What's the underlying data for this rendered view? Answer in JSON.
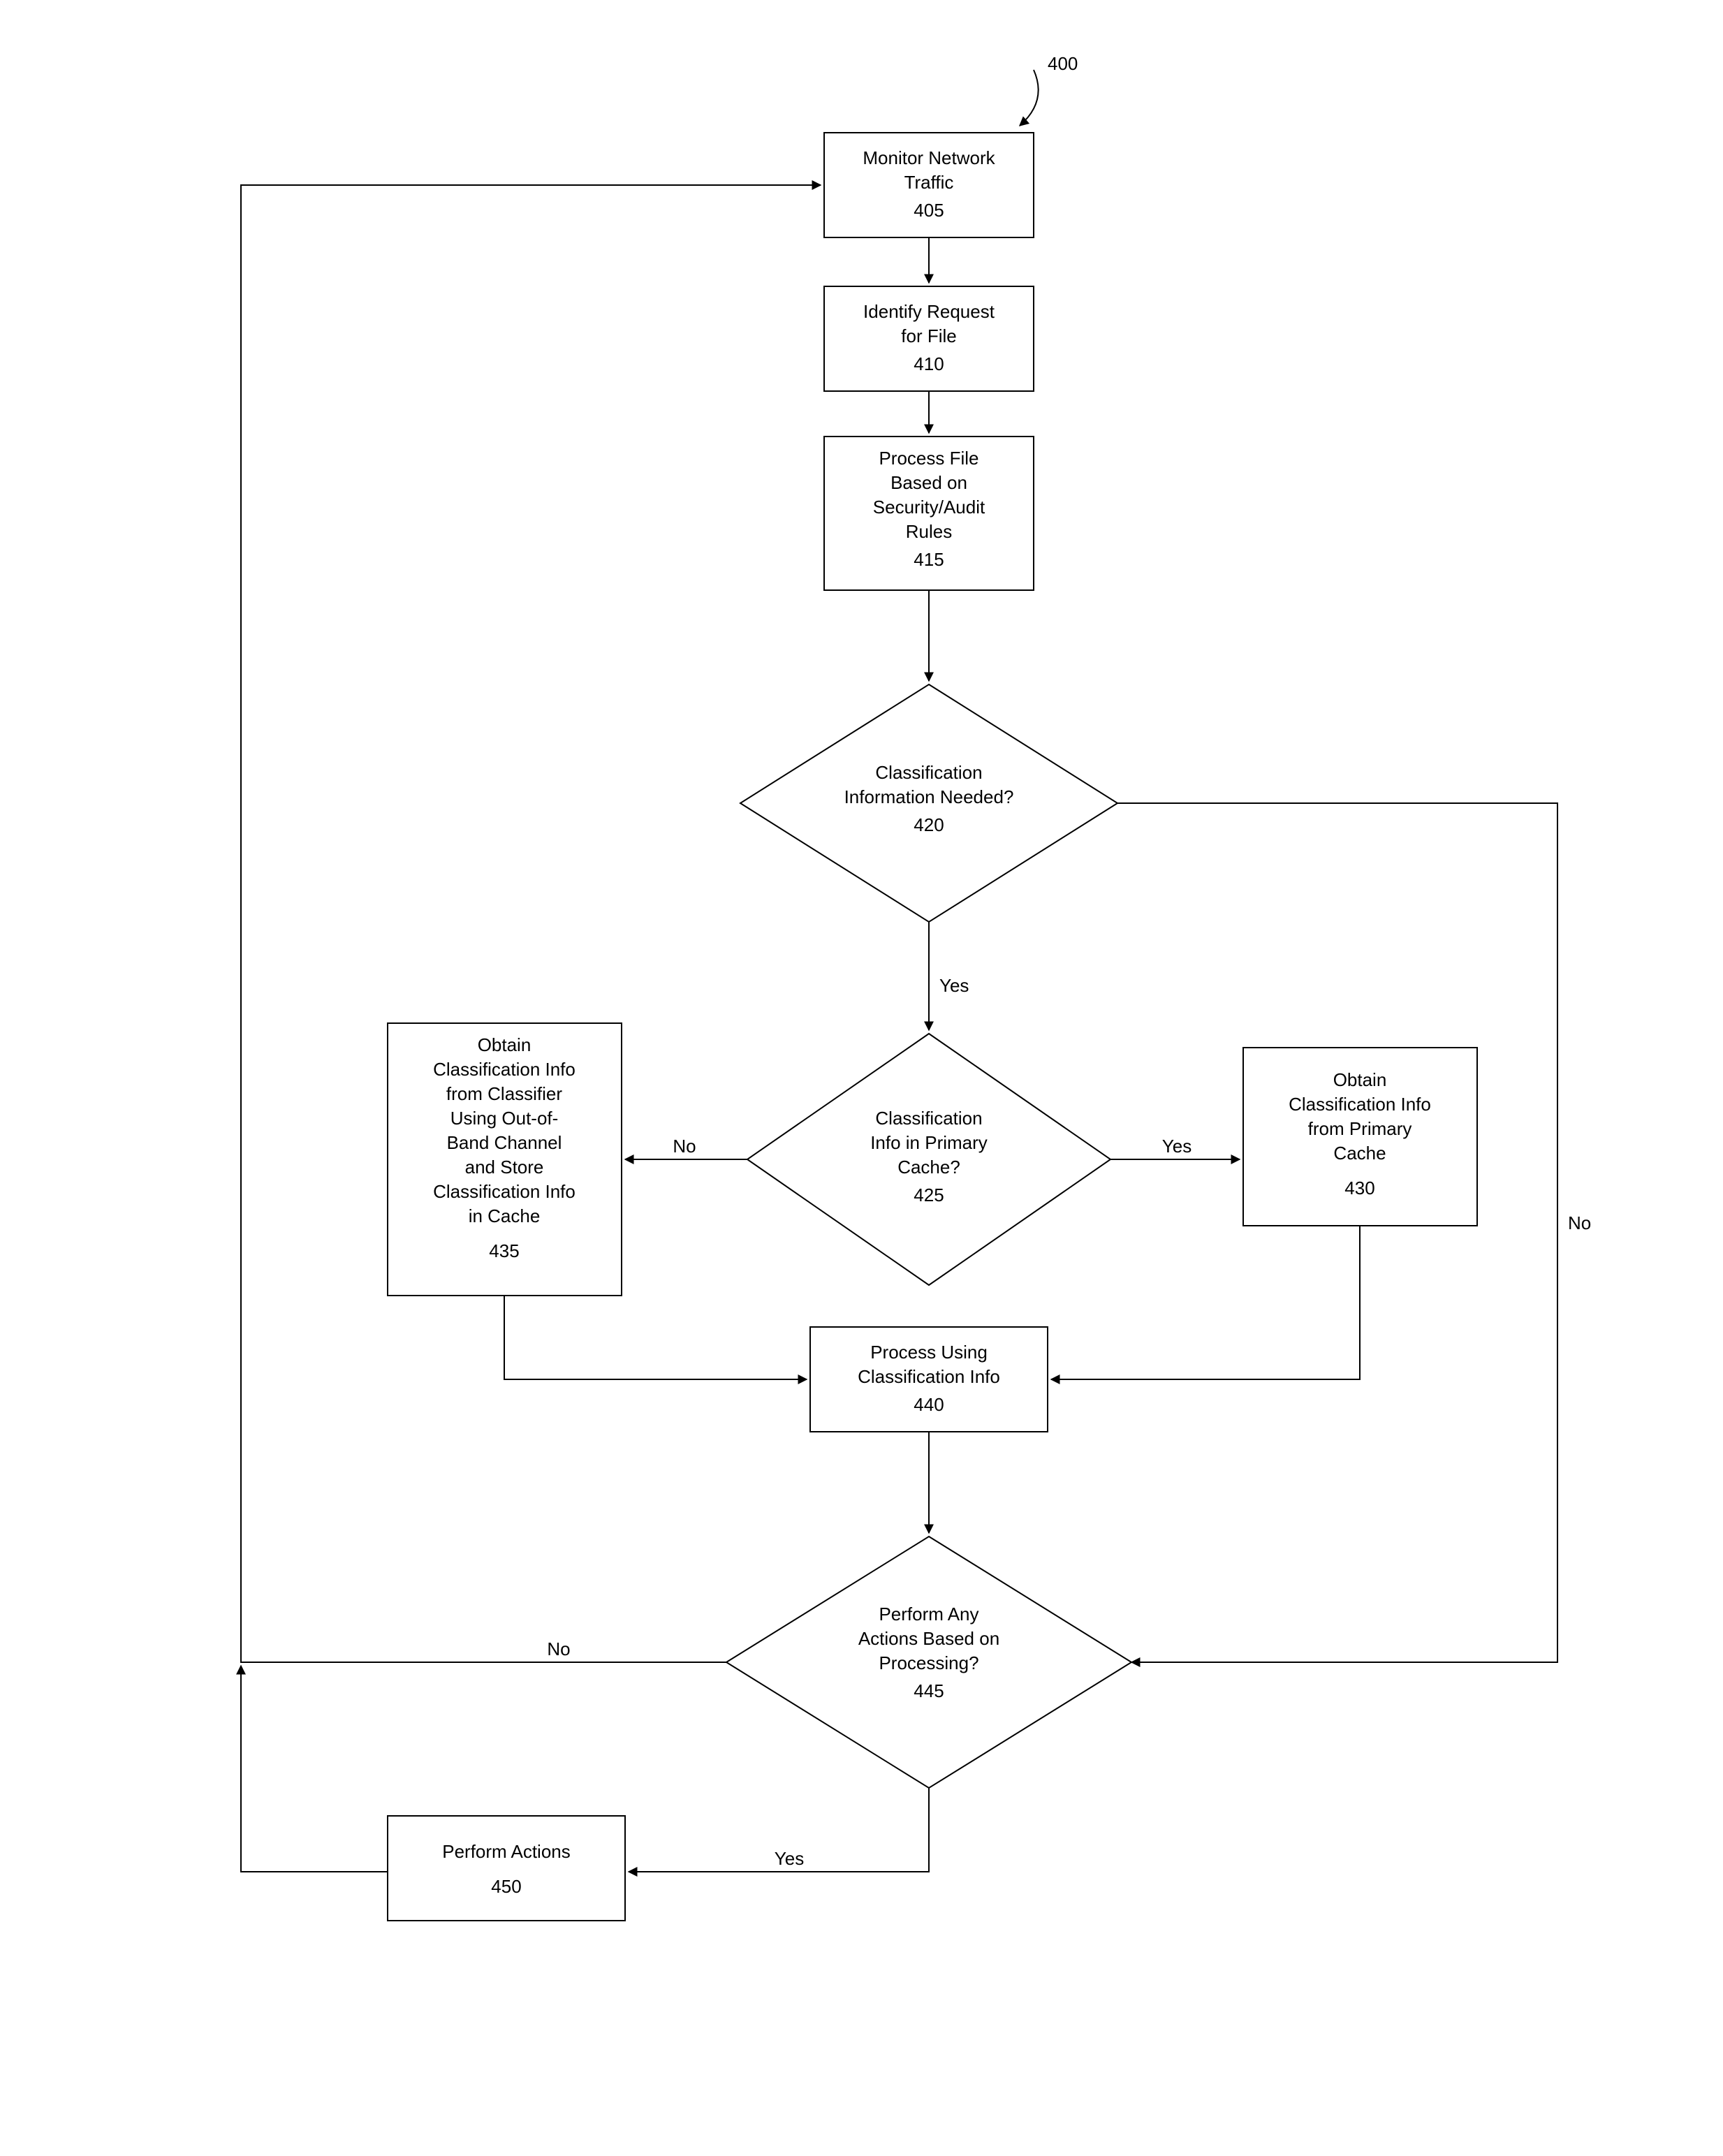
{
  "figure_ref": "400",
  "nodes": {
    "n405": {
      "l1": "Monitor Network",
      "l2": "Traffic",
      "num": "405"
    },
    "n410": {
      "l1": "Identify Request",
      "l2": "for File",
      "num": "410"
    },
    "n415": {
      "l1": "Process File",
      "l2": "Based on",
      "l3": "Security/Audit",
      "l4": "Rules",
      "num": "415"
    },
    "n420": {
      "l1": "Classification",
      "l2": "Information Needed?",
      "num": "420"
    },
    "n425": {
      "l1": "Classification",
      "l2": "Info in Primary",
      "l3": "Cache?",
      "num": "425"
    },
    "n430": {
      "l1": "Obtain",
      "l2": "Classification Info",
      "l3": "from Primary",
      "l4": "Cache",
      "num": "430"
    },
    "n435": {
      "l1": "Obtain",
      "l2": "Classification Info",
      "l3": "from Classifier",
      "l4": "Using Out-of-",
      "l5": "Band Channel",
      "l6": "and Store",
      "l7": "Classification Info",
      "l8": "in Cache",
      "num": "435"
    },
    "n440": {
      "l1": "Process Using",
      "l2": "Classification Info",
      "num": "440"
    },
    "n445": {
      "l1": "Perform Any",
      "l2": "Actions Based on",
      "l3": "Processing?",
      "num": "445"
    },
    "n450": {
      "l1": "Perform Actions",
      "num": "450"
    }
  },
  "labels": {
    "yes": "Yes",
    "no": "No"
  }
}
